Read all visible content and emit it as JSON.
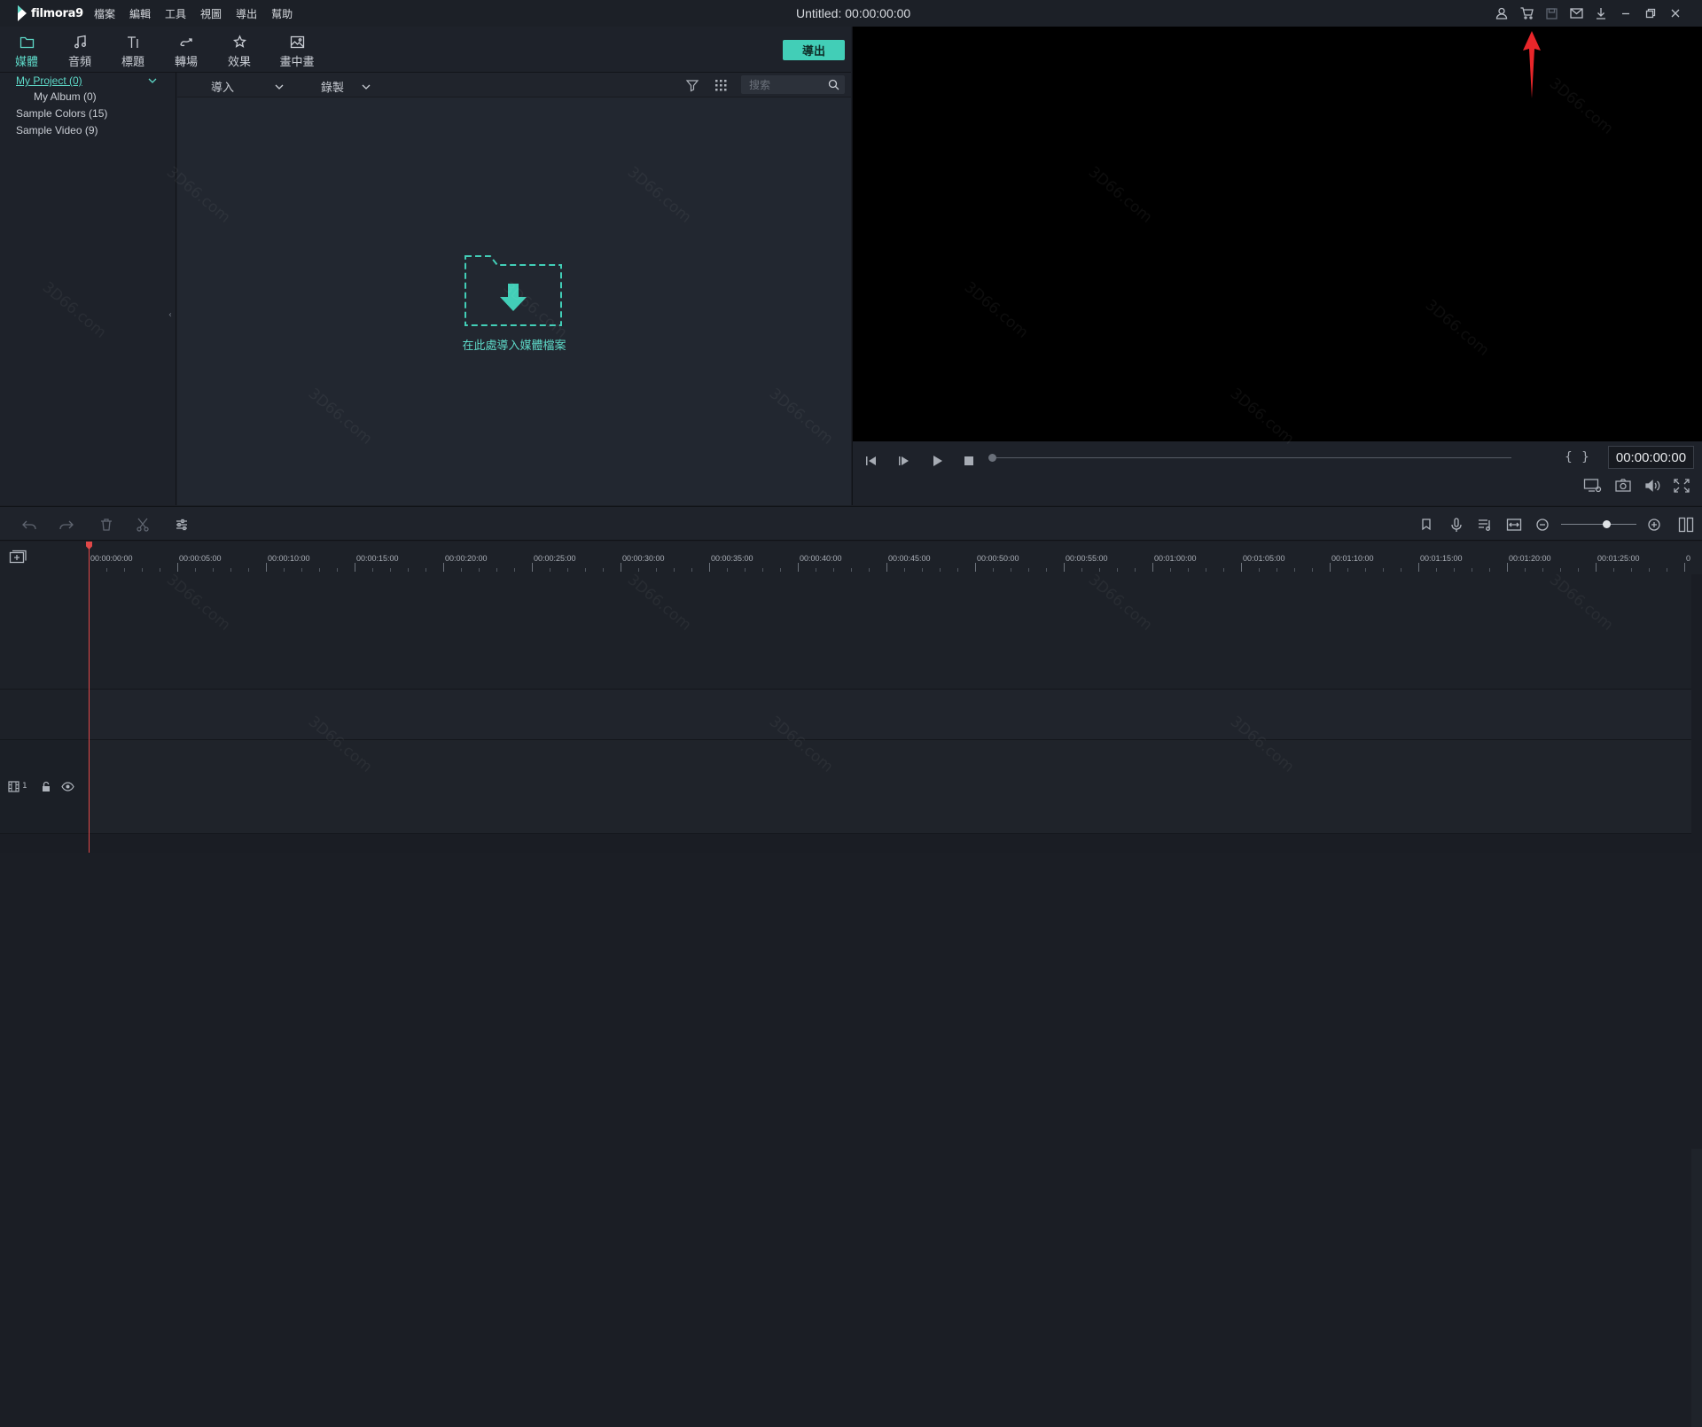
{
  "app": {
    "logo_text": "filmora9",
    "menu": [
      "檔案",
      "編輯",
      "工具",
      "視圖",
      "導出",
      "幫助"
    ],
    "document_title": "Untitled: 00:00:00:00"
  },
  "titlebar_icons": [
    "account-icon",
    "cart-icon",
    "save-icon",
    "mail-icon",
    "download-icon",
    "minimize-icon",
    "restore-icon",
    "close-icon"
  ],
  "library": {
    "tabs": [
      {
        "label": "媒體",
        "icon": "folder-icon",
        "active": true
      },
      {
        "label": "音頻",
        "icon": "music-note-icon",
        "active": false
      },
      {
        "label": "標題",
        "icon": "text-icon",
        "active": false
      },
      {
        "label": "轉場",
        "icon": "transition-icon",
        "active": false
      },
      {
        "label": "效果",
        "icon": "effects-icon",
        "active": false
      },
      {
        "label": "畫中畫",
        "icon": "image-icon",
        "active": false
      }
    ],
    "export_label": "導出",
    "tree": [
      {
        "label": "My Project (0)",
        "selected": true
      },
      {
        "label": "My Album (0)",
        "selected": false
      },
      {
        "label": "Sample Colors (15)",
        "selected": false
      },
      {
        "label": "Sample Video (9)",
        "selected": false
      }
    ],
    "import_label": "導入",
    "record_label": "錄製",
    "search_placeholder": "搜索",
    "drop_hint": "在此處導入媒體檔案"
  },
  "preview": {
    "timecode": "00:00:00:00",
    "brace_open": "{",
    "brace_close": "}"
  },
  "timeline": {
    "ruler_labels": [
      "00:00:00:00",
      "00:00:05:00",
      "00:00:10:00",
      "00:00:15:00",
      "00:00:20:00",
      "00:00:25:00",
      "00:00:30:00",
      "00:00:35:00",
      "00:00:40:00",
      "00:00:45:00",
      "00:00:50:00",
      "00:00:55:00",
      "00:01:00:00",
      "00:01:05:00",
      "00:01:10:00",
      "00:01:15:00",
      "00:01:20:00",
      "00:01:25:00",
      "0"
    ],
    "track_number": "1"
  },
  "watermark_text": "3D66.com",
  "colors": {
    "accent": "#42ceb7",
    "accent_text": "#5ed9c8",
    "playhead": "#e04848",
    "annotation_arrow": "#e8262a"
  }
}
